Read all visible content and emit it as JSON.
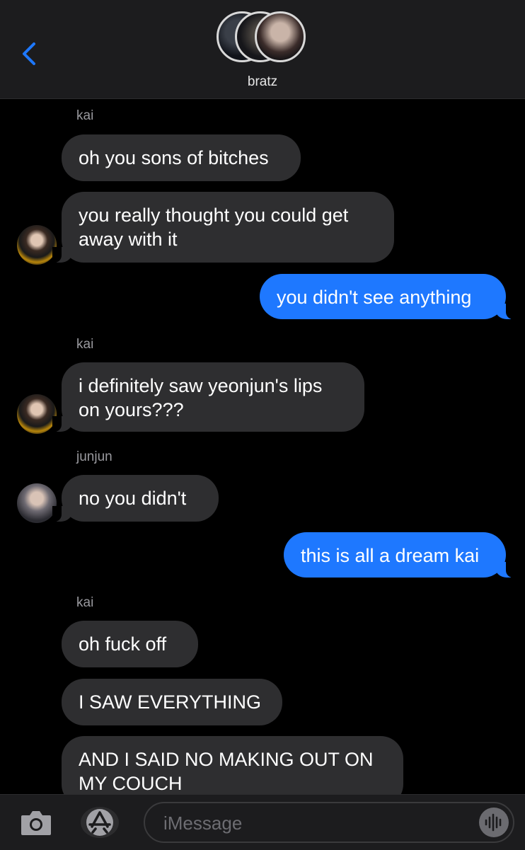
{
  "header": {
    "group_name": "bratz",
    "back_icon": "chevron-left-icon"
  },
  "messages": [
    {
      "sender": "kai"
    },
    {
      "text": "oh you sons of bitches"
    },
    {
      "text": "you really thought you could get\naway with it"
    },
    {
      "text": "you didn't see anything"
    },
    {
      "sender": "kai"
    },
    {
      "text": "i definitely saw yeonjun's lips\non yours???"
    },
    {
      "sender": "junjun"
    },
    {
      "text": "no you didn't"
    },
    {
      "text": "this is all a dream kai"
    },
    {
      "sender": "kai"
    },
    {
      "text": "oh fuck off"
    },
    {
      "text": "I SAW EVERYTHING"
    },
    {
      "text": "AND I SAID NO MAKING OUT ON\nMY COUCH"
    }
  ],
  "input": {
    "placeholder": "iMessage"
  },
  "icons": {
    "camera": "camera-icon",
    "apps": "app-store-icon",
    "audio": "waveform-icon"
  },
  "colors": {
    "outgoing_bubble": "#1e78ff",
    "incoming_bubble": "#2e2e30",
    "back_chevron": "#1e78ff"
  }
}
